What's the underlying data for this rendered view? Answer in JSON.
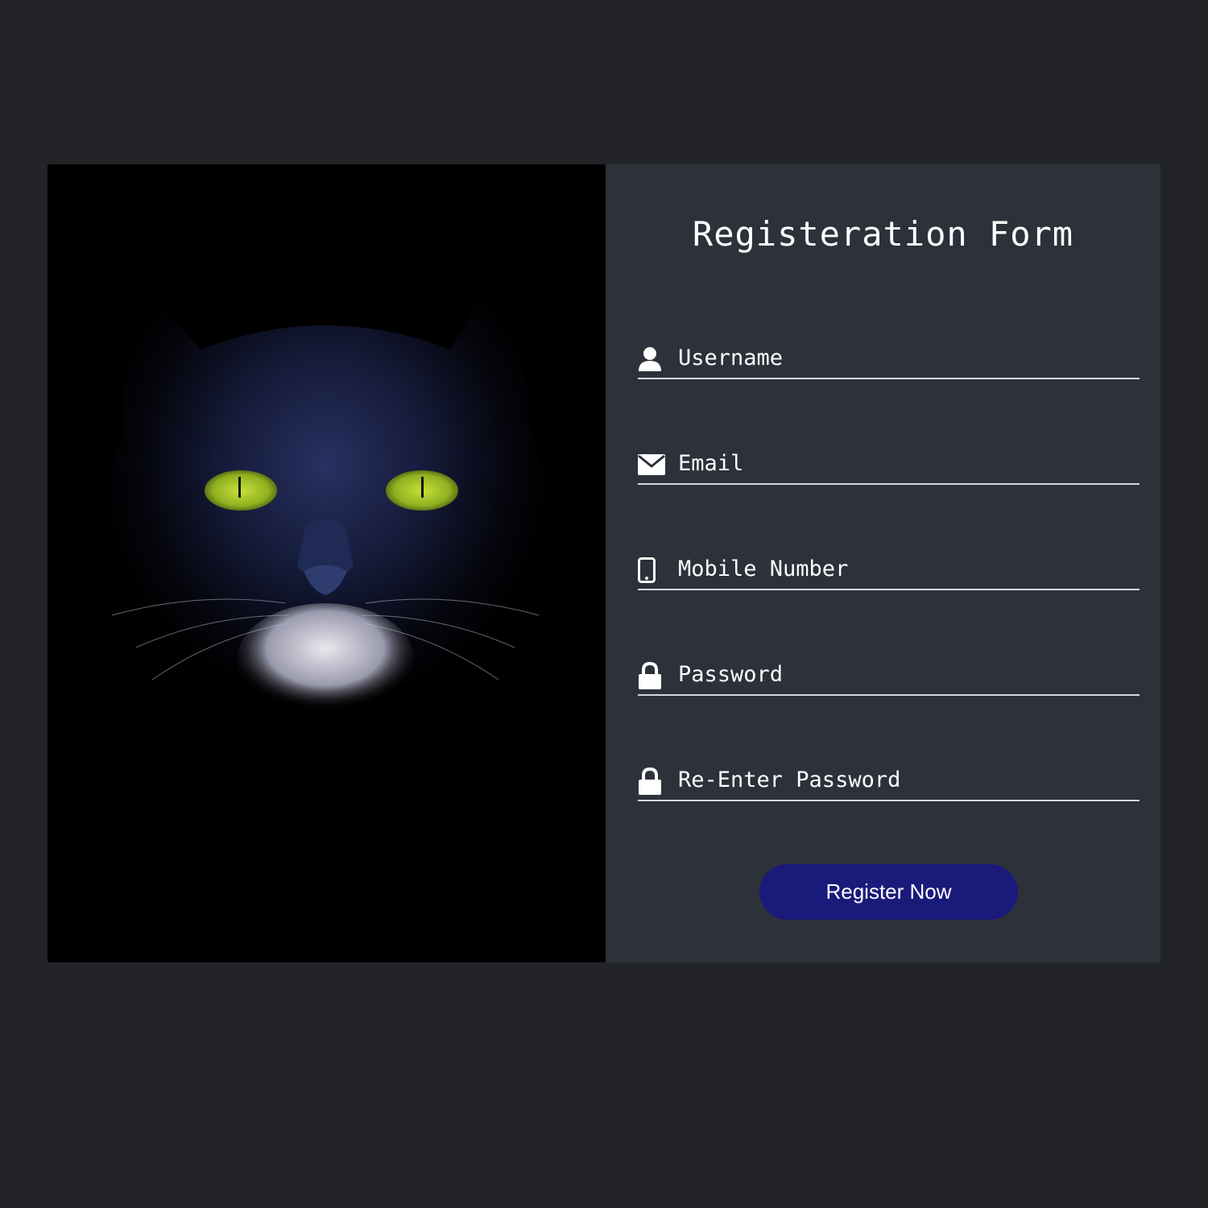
{
  "form": {
    "title": "Registeration Form",
    "fields": [
      {
        "name": "username",
        "icon": "user-icon",
        "placeholder": "Username",
        "value": ""
      },
      {
        "name": "email",
        "icon": "envelope-icon",
        "placeholder": "Email",
        "value": ""
      },
      {
        "name": "mobile",
        "icon": "mobile-phone-icon",
        "placeholder": "Mobile Number",
        "value": ""
      },
      {
        "name": "password",
        "icon": "lock-icon",
        "placeholder": "Password",
        "value": ""
      },
      {
        "name": "confirm-password",
        "icon": "lock-icon",
        "placeholder": "Re-Enter Password",
        "value": ""
      }
    ],
    "submit_label": "Register Now"
  },
  "colors": {
    "page_background": "#232428",
    "form_background": "#2c313a",
    "button_background": "#1a1a7a",
    "text": "#ffffff"
  }
}
